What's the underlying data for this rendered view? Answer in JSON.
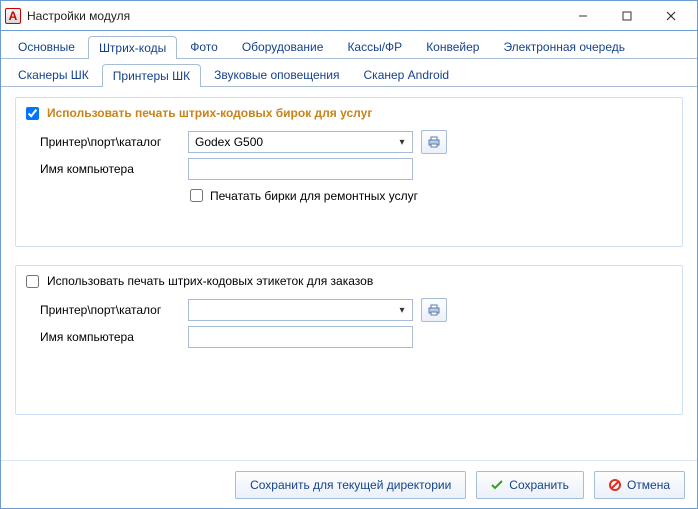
{
  "window": {
    "title": "Настройки модуля"
  },
  "tabs": {
    "main": [
      "Основные",
      "Штрих-коды",
      "Фото",
      "Оборудование",
      "Кассы/ФР",
      "Конвейер",
      "Электронная очередь"
    ],
    "main_active_index": 1,
    "sub": [
      "Сканеры ШК",
      "Принтеры ШК",
      "Звуковые оповещения",
      "Сканер Android"
    ],
    "sub_active_index": 1
  },
  "section1": {
    "checkbox_label": "Использовать печать штрих-кодовых бирок для услуг",
    "checkbox_checked": true,
    "printer_label": "Принтер\\порт\\каталог",
    "printer_value": "Godex G500",
    "computer_label": "Имя компьютера",
    "computer_value": "",
    "sub_checkbox_label": "Печатать бирки для ремонтных услуг",
    "sub_checkbox_checked": false
  },
  "section2": {
    "checkbox_label": "Использовать печать штрих-кодовых этикеток для заказов",
    "checkbox_checked": false,
    "printer_label": "Принтер\\порт\\каталог",
    "printer_value": "",
    "computer_label": "Имя компьютера",
    "computer_value": ""
  },
  "footer": {
    "save_current_dir": "Сохранить для текущей директории",
    "save": "Сохранить",
    "cancel": "Отмена"
  }
}
